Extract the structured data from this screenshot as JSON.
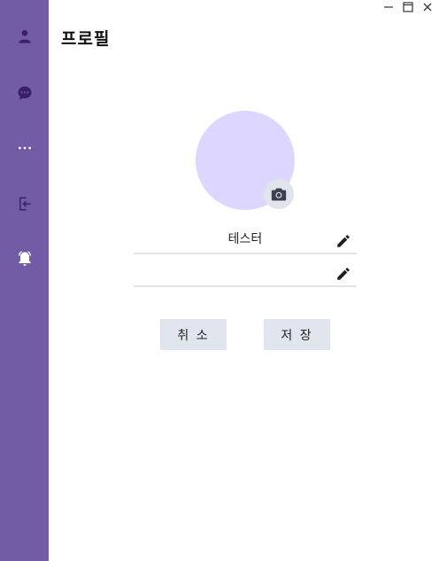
{
  "window": {
    "controls": [
      "minimize-icon",
      "maximize-icon",
      "close-icon"
    ]
  },
  "sidebar": {
    "background": "#735ca6",
    "items": [
      {
        "icon": "user-icon",
        "state": "selected"
      },
      {
        "icon": "chat-bubble-icon"
      },
      {
        "icon": "more-icon"
      },
      {
        "icon": "logout-icon"
      },
      {
        "icon": "bell-icon"
      }
    ]
  },
  "page": {
    "title": "프로필"
  },
  "profile": {
    "avatar_color": "#ddd6fe",
    "camera_icon": "camera-icon",
    "name_value": "테스터",
    "status_value": "",
    "edit_icon": "pencil-icon"
  },
  "actions": {
    "cancel_label": "취 소",
    "save_label": "저 장",
    "button_color": "#e1e6ee"
  }
}
